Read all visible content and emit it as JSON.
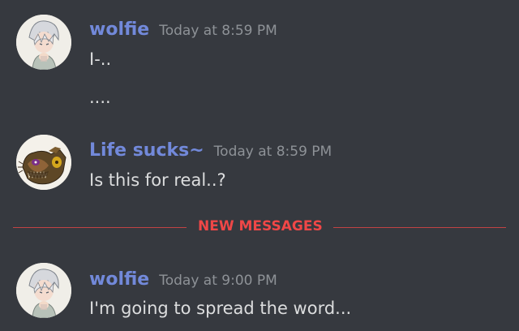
{
  "colors": {
    "background": "#36393f",
    "username": "#7289da",
    "timestamp": "#8e9297",
    "message_text": "#dcddde",
    "new_messages": "#f04747"
  },
  "messages": [
    {
      "author": "wolfie",
      "timestamp": "Today at 8:59 PM",
      "avatar_icon": "white-haired-anime-character-avatar",
      "lines": [
        "I-..",
        "...."
      ]
    },
    {
      "author": "Life sucks~",
      "timestamp": "Today at 8:59 PM",
      "avatar_icon": "animatronic-face-avatar",
      "lines": [
        "Is this for real..?"
      ]
    },
    {
      "author": "wolfie",
      "timestamp": "Today at 9:00 PM",
      "avatar_icon": "white-haired-anime-character-avatar",
      "lines": [
        "I'm going to spread the word..."
      ]
    }
  ],
  "divider": {
    "label": "NEW MESSAGES"
  }
}
